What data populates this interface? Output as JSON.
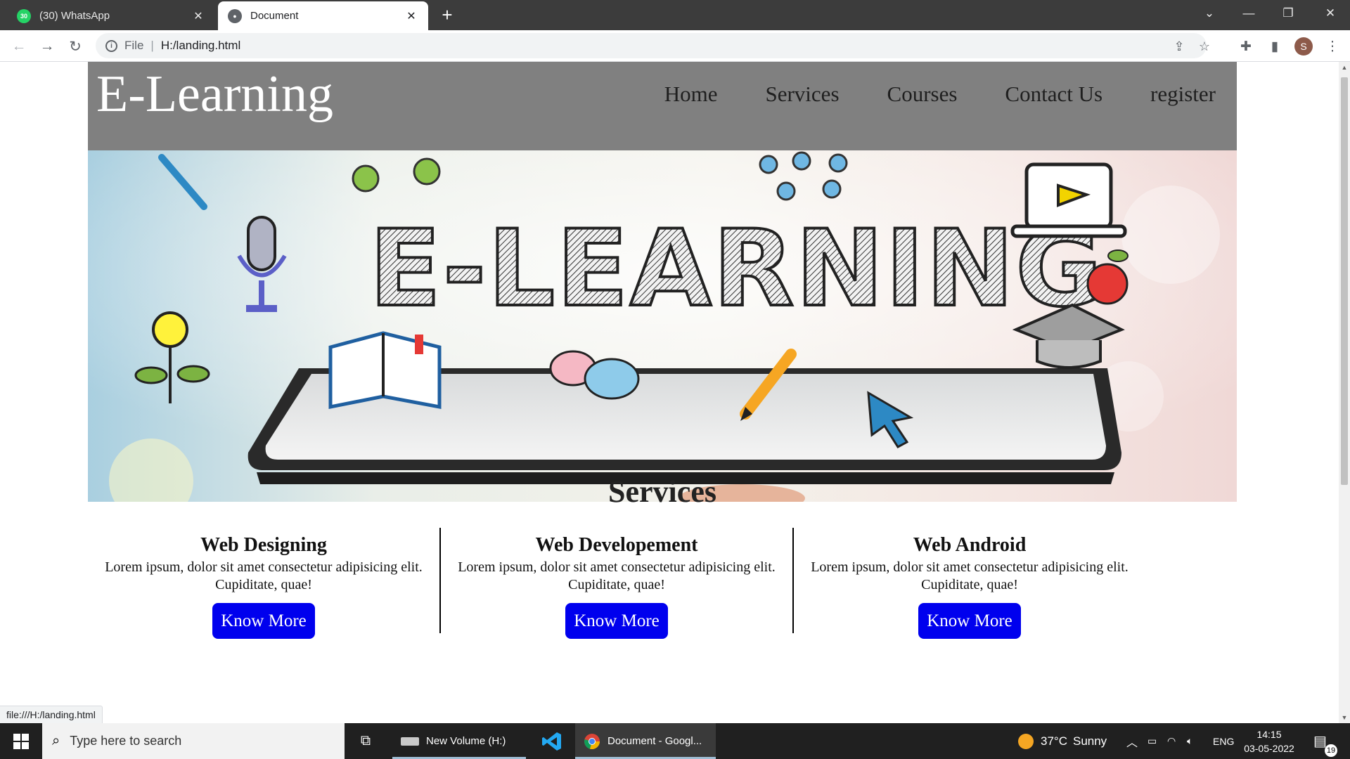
{
  "browser": {
    "tabs": [
      {
        "label": "(30) WhatsApp",
        "badge": "30",
        "active": false
      },
      {
        "label": "Document",
        "active": true
      }
    ],
    "new_tab": "+",
    "address": {
      "scheme": "File",
      "url": "H:/landing.html"
    },
    "profile_initial": "S",
    "status_url": "file:///H:/landing.html"
  },
  "site": {
    "brand": "E-Learning",
    "nav": [
      "Home",
      "Services",
      "Courses",
      "Contact Us",
      "register"
    ],
    "hero": {
      "headline": "E-LEARNING"
    },
    "services": {
      "title": "Services",
      "items": [
        {
          "title": "Web Designing",
          "text_line1": "Lorem ipsum, dolor sit amet consectetur adipisicing elit.",
          "text_line2": "Cupiditate, quae!",
          "button": "Know More"
        },
        {
          "title": "Web Developement",
          "text_line1": "Lorem ipsum, dolor sit amet consectetur adipisicing elit.",
          "text_line2": "Cupiditate, quae!",
          "button": "Know More"
        },
        {
          "title": "Web Android",
          "text_line1": "Lorem ipsum, dolor sit amet consectetur adipisicing elit.",
          "text_line2": "Cupiditate, quae!",
          "button": "Know More"
        }
      ]
    }
  },
  "taskbar": {
    "search_placeholder": "Type here to search",
    "apps": [
      {
        "label": "New Volume (H:)"
      },
      {
        "label": "Document - Googl..."
      }
    ],
    "weather": {
      "temp": "37°C",
      "condition": "Sunny"
    },
    "language": "ENG",
    "time": "14:15",
    "date": "03-05-2022",
    "notification_count": "19"
  },
  "colors": {
    "header_bg": "#808080",
    "button_bg": "#0000ee",
    "tabstrip_bg": "#3c3c3c",
    "taskbar_bg": "#202020"
  }
}
